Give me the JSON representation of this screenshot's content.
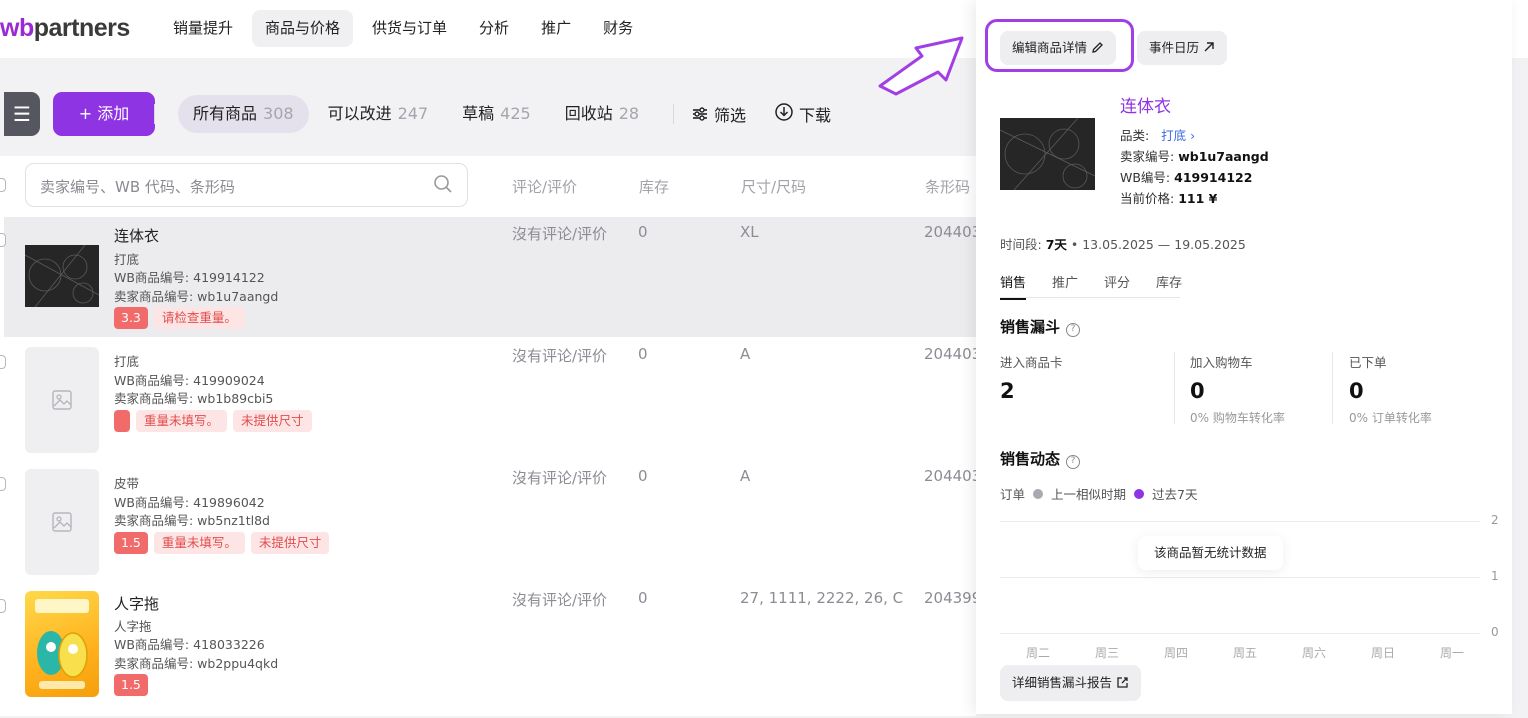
{
  "brand": {
    "prefix": "wb",
    "rest": "partners"
  },
  "nav": [
    "销量提升",
    "商品与价格",
    "供货与订单",
    "分析",
    "推广",
    "财务"
  ],
  "toolbar": {
    "add_label": "+ 添加",
    "tabs": [
      {
        "label": "所有商品",
        "count": "308"
      },
      {
        "label": "可以改进",
        "count": "247"
      },
      {
        "label": "草稿",
        "count": "425"
      },
      {
        "label": "回收站",
        "count": "28"
      }
    ],
    "filter_label": "筛选",
    "download_label": "下载"
  },
  "table": {
    "search_placeholder": "卖家编号、WB 代码、条形码",
    "headers": [
      "评论/评价",
      "库存",
      "尺寸/尺码",
      "条形码"
    ],
    "rows": [
      {
        "name": "连体衣",
        "category": "打底",
        "wb_id": "WB商品编号: 419914122",
        "seller_id": "卖家商品编号: wb1u7aangd",
        "rating": "3.3",
        "warnings": [
          "请检查重量。"
        ],
        "reviews": "沒有评论/评价",
        "stock": "0",
        "size": "XL",
        "barcode": "204403"
      },
      {
        "name": "",
        "category": "打底",
        "wb_id": "WB商品编号: 419909024",
        "seller_id": "卖家商品编号: wb1b89cbi5",
        "rating": "",
        "warnings": [
          "重量未填写。",
          "未提供尺寸"
        ],
        "reviews": "沒有评论/评价",
        "stock": "0",
        "size": "A",
        "barcode": "204403"
      },
      {
        "name": "",
        "category": "皮带",
        "wb_id": "WB商品编号: 419896042",
        "seller_id": "卖家商品编号: wb5nz1tl8d",
        "rating": "1.5",
        "warnings": [
          "重量未填写。",
          "未提供尺寸"
        ],
        "reviews": "沒有评论/评价",
        "stock": "0",
        "size": "A",
        "barcode": "204403"
      },
      {
        "name": "人字拖",
        "category": "人字拖",
        "wb_id": "WB商品编号: 418033226",
        "seller_id": "卖家商品编号: wb2ppu4qkd",
        "rating": "1.5",
        "warnings": [],
        "reviews": "沒有评论/评价",
        "stock": "0",
        "size": "27, 1111, 2222, 26, C",
        "barcode": "204399"
      }
    ]
  },
  "drawer": {
    "edit_label": "编辑商品详情",
    "calendar_label": "事件日历",
    "title": "连体衣",
    "category_label": "品类:",
    "category_value": "打底",
    "seller_label": "卖家编号:",
    "seller_value": "wb1u7aangd",
    "wb_label": "WB编号:",
    "wb_value": "419914122",
    "price_label": "当前价格:",
    "price_value": "111 ¥",
    "period_label": "时间段:",
    "period_value": "7天",
    "period_range": "13.05.2025 — 19.05.2025",
    "tabs": [
      "销售",
      "推广",
      "评分",
      "库存"
    ],
    "funnel_title": "销售漏斗",
    "stats": [
      {
        "label": "进入商品卡",
        "value": "2",
        "sub": ""
      },
      {
        "label": "加入购物车",
        "value": "0",
        "sub": "0% 购物车转化率"
      },
      {
        "label": "已下单",
        "value": "0",
        "sub": "0% 订单转化率"
      }
    ],
    "dynamics_title": "销售动态",
    "legend_prefix": "订单",
    "legend_prev": "上一相似时期",
    "legend_curr": "过去7天",
    "colors": {
      "prev": "#a9a9b0",
      "curr": "#8f34e3"
    },
    "no_data": "该商品暂无统计数据",
    "report_label": "详细销售漏斗报告"
  },
  "chart_data": {
    "type": "line",
    "categories": [
      "周二",
      "周三",
      "周四",
      "周五",
      "周六",
      "周日",
      "周一"
    ],
    "yticks": [
      "2",
      "1",
      "0"
    ],
    "ylim": [
      0,
      2
    ],
    "series": [],
    "title": "",
    "xlabel": "",
    "ylabel": ""
  }
}
